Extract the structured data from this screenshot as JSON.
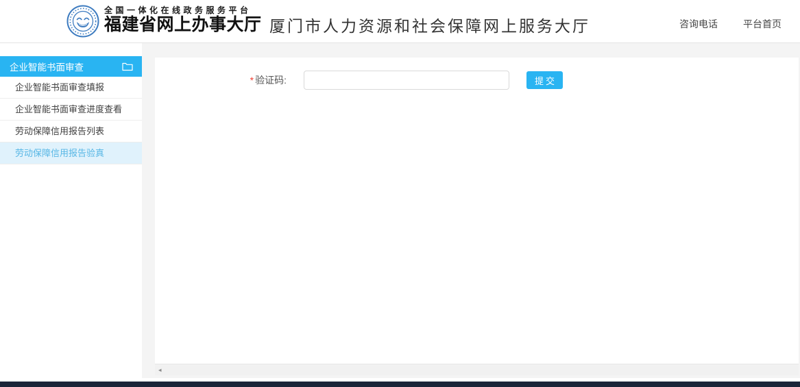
{
  "header": {
    "platform_tagline": "全国一体化在线政务服务平台",
    "portal_name": "福建省网上办事大厅",
    "site_title": "厦门市人力资源和社会保障网上服务大厅",
    "links": [
      {
        "label": "咨询电话"
      },
      {
        "label": "平台首页"
      }
    ]
  },
  "sidebar": {
    "header": {
      "label": "企业智能书面审查",
      "icon": "folder-icon"
    },
    "items": [
      {
        "label": "企业智能书面审查填报",
        "selected": false
      },
      {
        "label": "企业智能书面审查进度查看",
        "selected": false
      },
      {
        "label": "劳动保障信用报告列表",
        "selected": false
      },
      {
        "label": "劳动保障信用报告验真",
        "selected": true
      }
    ]
  },
  "main": {
    "form": {
      "required_marker": "*",
      "captcha_label": "验证码:",
      "captcha_value": "",
      "submit_label": "提交"
    },
    "scrollbar_arrow": "◂"
  },
  "colors": {
    "accent_blue": "#29b4f2",
    "sidebar_selected_bg": "#e0f2fc",
    "sidebar_selected_text": "#58b7e5",
    "logo_blue": "#3e7cc0",
    "required_red": "#f04134",
    "bottom_bar": "#1b2438"
  }
}
